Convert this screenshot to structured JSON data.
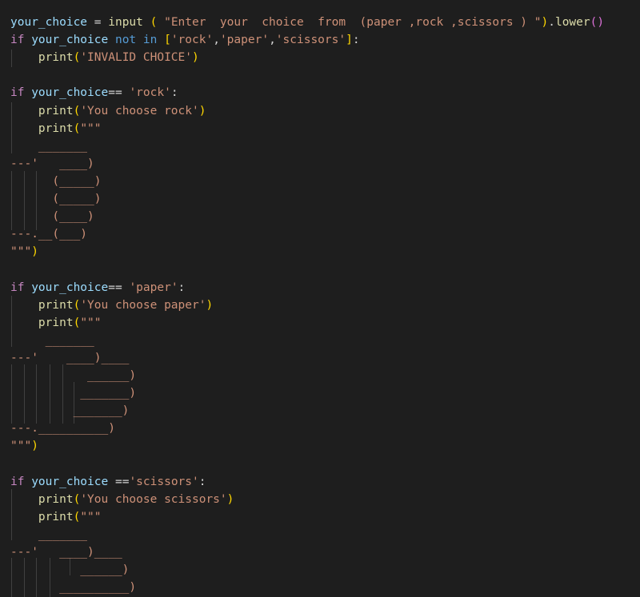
{
  "editor": {
    "theme_colors": {
      "background": "#1e1e1e",
      "identifier": "#9cdcfe",
      "plain": "#d4d4d4",
      "function": "#dcdcaa",
      "keyword_control": "#c586c0",
      "keyword_operator": "#569cd6",
      "string": "#ce9178",
      "bracket_level1": "#ffd700",
      "bracket_level2": "#da70d6",
      "bracket_level3": "#179fff"
    },
    "lines": [
      {
        "tokens": [
          [
            "ident",
            "your_choice"
          ],
          [
            "plain",
            " = "
          ],
          [
            "fn",
            "input"
          ],
          [
            "plain",
            " "
          ],
          [
            "br1",
            "("
          ],
          [
            "plain",
            " "
          ],
          [
            "str",
            "\"Enter  your  choice  from  (paper ,rock ,scissors ) \""
          ],
          [
            "br1",
            ")"
          ],
          [
            "plain",
            "."
          ],
          [
            "fn",
            "lower"
          ],
          [
            "br2",
            "()"
          ]
        ]
      },
      {
        "tokens": [
          [
            "kw",
            "if"
          ],
          [
            "plain",
            " "
          ],
          [
            "ident",
            "your_choice"
          ],
          [
            "plain",
            " "
          ],
          [
            "kwblue",
            "not in"
          ],
          [
            "plain",
            " "
          ],
          [
            "br1",
            "["
          ],
          [
            "str",
            "'rock'"
          ],
          [
            "plain",
            ","
          ],
          [
            "str",
            "'paper'"
          ],
          [
            "plain",
            ","
          ],
          [
            "str",
            "'scissors'"
          ],
          [
            "br1",
            "]"
          ],
          [
            "plain",
            ":"
          ]
        ]
      },
      {
        "tokens": [
          [
            "plain",
            "    "
          ],
          [
            "fn",
            "print"
          ],
          [
            "br1",
            "("
          ],
          [
            "str",
            "'INVALID CHOICE'"
          ],
          [
            "br1",
            ")"
          ]
        ]
      },
      {
        "tokens": []
      },
      {
        "tokens": [
          [
            "kw",
            "if"
          ],
          [
            "plain",
            " "
          ],
          [
            "ident",
            "your_choice"
          ],
          [
            "plain",
            "== "
          ],
          [
            "str",
            "'rock'"
          ],
          [
            "plain",
            ":"
          ]
        ]
      },
      {
        "tokens": [
          [
            "plain",
            "    "
          ],
          [
            "fn",
            "print"
          ],
          [
            "br1",
            "("
          ],
          [
            "str",
            "'You choose rock'"
          ],
          [
            "br1",
            ")"
          ]
        ]
      },
      {
        "tokens": [
          [
            "plain",
            "    "
          ],
          [
            "fn",
            "print"
          ],
          [
            "br1",
            "("
          ],
          [
            "str",
            "\"\"\""
          ]
        ]
      },
      {
        "tokens": [
          [
            "str",
            "    _______"
          ]
        ]
      },
      {
        "tokens": [
          [
            "str",
            "---'   ____)"
          ]
        ]
      },
      {
        "tokens": [
          [
            "str",
            "      (_____)"
          ]
        ]
      },
      {
        "tokens": [
          [
            "str",
            "      (_____)"
          ]
        ]
      },
      {
        "tokens": [
          [
            "str",
            "      (____)"
          ]
        ]
      },
      {
        "tokens": [
          [
            "str",
            "---.__(___)"
          ]
        ]
      },
      {
        "tokens": [
          [
            "str",
            "\"\"\""
          ],
          [
            "br1",
            ")"
          ]
        ]
      },
      {
        "tokens": []
      },
      {
        "tokens": [
          [
            "kw",
            "if"
          ],
          [
            "plain",
            " "
          ],
          [
            "ident",
            "your_choice"
          ],
          [
            "plain",
            "== "
          ],
          [
            "str",
            "'paper'"
          ],
          [
            "plain",
            ":"
          ]
        ]
      },
      {
        "tokens": [
          [
            "plain",
            "    "
          ],
          [
            "fn",
            "print"
          ],
          [
            "br1",
            "("
          ],
          [
            "str",
            "'You choose paper'"
          ],
          [
            "br1",
            ")"
          ]
        ]
      },
      {
        "tokens": [
          [
            "plain",
            "    "
          ],
          [
            "fn",
            "print"
          ],
          [
            "br1",
            "("
          ],
          [
            "str",
            "\"\"\""
          ]
        ]
      },
      {
        "tokens": [
          [
            "str",
            "     _______"
          ]
        ]
      },
      {
        "tokens": [
          [
            "str",
            "---'    ____)____"
          ]
        ]
      },
      {
        "tokens": [
          [
            "str",
            "           ______)"
          ]
        ]
      },
      {
        "tokens": [
          [
            "str",
            "          _______)"
          ]
        ]
      },
      {
        "tokens": [
          [
            "str",
            "         _______)"
          ]
        ]
      },
      {
        "tokens": [
          [
            "str",
            "---.__________)"
          ]
        ]
      },
      {
        "tokens": [
          [
            "str",
            "\"\"\""
          ],
          [
            "br1",
            ")"
          ]
        ]
      },
      {
        "tokens": []
      },
      {
        "tokens": [
          [
            "kw",
            "if"
          ],
          [
            "plain",
            " "
          ],
          [
            "ident",
            "your_choice"
          ],
          [
            "plain",
            " =="
          ],
          [
            "str",
            "'scissors'"
          ],
          [
            "plain",
            ":"
          ]
        ]
      },
      {
        "tokens": [
          [
            "plain",
            "    "
          ],
          [
            "fn",
            "print"
          ],
          [
            "br1",
            "("
          ],
          [
            "str",
            "'You choose scissors'"
          ],
          [
            "br1",
            ")"
          ]
        ]
      },
      {
        "tokens": [
          [
            "plain",
            "    "
          ],
          [
            "fn",
            "print"
          ],
          [
            "br1",
            "("
          ],
          [
            "str",
            "\"\"\""
          ]
        ]
      },
      {
        "tokens": [
          [
            "str",
            "    _______"
          ]
        ]
      },
      {
        "tokens": [
          [
            "str",
            "---'   ____)____"
          ]
        ]
      },
      {
        "tokens": [
          [
            "str",
            "          ______)"
          ]
        ]
      },
      {
        "tokens": [
          [
            "str",
            "       __________)"
          ]
        ]
      }
    ]
  }
}
